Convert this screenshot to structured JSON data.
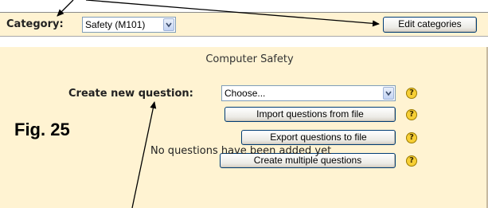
{
  "header": {
    "category_label": "Category:",
    "category_select": {
      "selected": "Safety (M101)"
    },
    "edit_categories_label": "Edit categories"
  },
  "main": {
    "section_title": "Computer Safety",
    "create_question": {
      "label": "Create new question:",
      "select": {
        "selected": "Choose..."
      },
      "help_glyph": "?"
    },
    "buttons": {
      "import": "Import questions from file",
      "export": "Export questions to file",
      "create_multiple": "Create multiple questions"
    },
    "empty_message": "No questions have been added yet"
  },
  "annotation": {
    "figure_label": "Fig. 25"
  },
  "colors": {
    "panel_background": "#fff3d2",
    "button_border": "#003c74",
    "help_icon": "#f7cf35"
  },
  "icons": [
    "chevron-down-icon",
    "help-icon",
    "annotation-arrow"
  ]
}
